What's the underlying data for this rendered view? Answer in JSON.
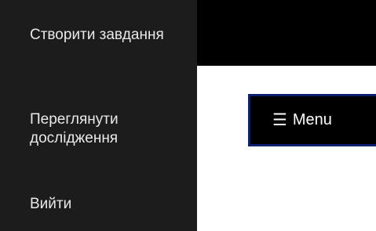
{
  "sidebar": {
    "items": [
      {
        "label": "Створити завдання"
      },
      {
        "label": "Переглянути дослідження"
      },
      {
        "label": "Вийти"
      }
    ]
  },
  "header": {
    "menu_button": {
      "icon": "☰",
      "icon_name": "hamburger-icon",
      "label": "Menu"
    }
  },
  "colors": {
    "sidebar_bg": "#1c1c1c",
    "top_bar_bg": "#000000",
    "content_bg": "#ffffff",
    "menu_button_bg": "#000000",
    "menu_button_border": "#0b1f6e"
  }
}
